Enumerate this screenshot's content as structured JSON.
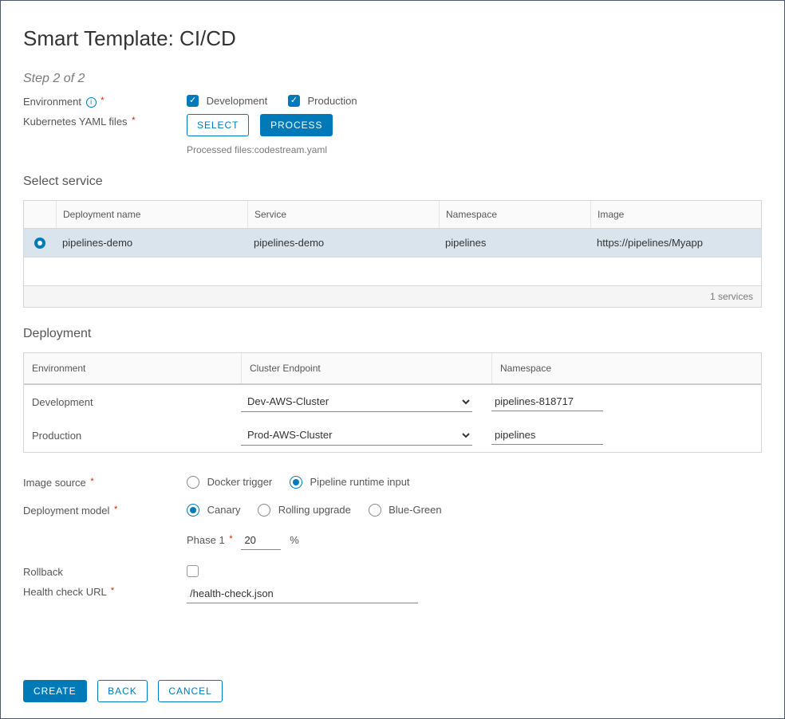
{
  "title": "Smart Template: CI/CD",
  "step": "Step 2 of 2",
  "labels": {
    "environment": "Environment",
    "k8s": "Kubernetes YAML files",
    "select": "Select",
    "process": "Process",
    "processed": "Processed files:codestream.yaml",
    "select_service": "Select service",
    "deployment": "Deployment",
    "image_source": "Image source",
    "deployment_model": "Deployment model",
    "rollback": "Rollback",
    "health_check": "Health check URL",
    "phase1": "Phase 1",
    "percent": "%",
    "create": "Create",
    "back": "Back",
    "cancel": "Cancel"
  },
  "env_options": {
    "dev": "Development",
    "prod": "Production"
  },
  "service_table": {
    "headers": {
      "deployment": "Deployment name",
      "service": "Service",
      "namespace": "Namespace",
      "image": "Image"
    },
    "rows": [
      {
        "deployment": "pipelines-demo",
        "service": "pipelines-demo",
        "namespace": "pipelines",
        "image": "https://pipelines/Myapp"
      }
    ],
    "footer": "1 services"
  },
  "deployment_table": {
    "headers": {
      "env": "Environment",
      "cluster": "Cluster Endpoint",
      "ns": "Namespace"
    },
    "rows": [
      {
        "env": "Development",
        "cluster": "Dev-AWS-Cluster",
        "ns": "pipelines-818717"
      },
      {
        "env": "Production",
        "cluster": "Prod-AWS-Cluster",
        "ns": "pipelines"
      }
    ]
  },
  "image_source": {
    "docker": "Docker trigger",
    "runtime": "Pipeline runtime input"
  },
  "deployment_model": {
    "canary": "Canary",
    "rolling": "Rolling upgrade",
    "bluegreen": "Blue-Green"
  },
  "phase1_value": "20",
  "health_check_value": "/health-check.json"
}
